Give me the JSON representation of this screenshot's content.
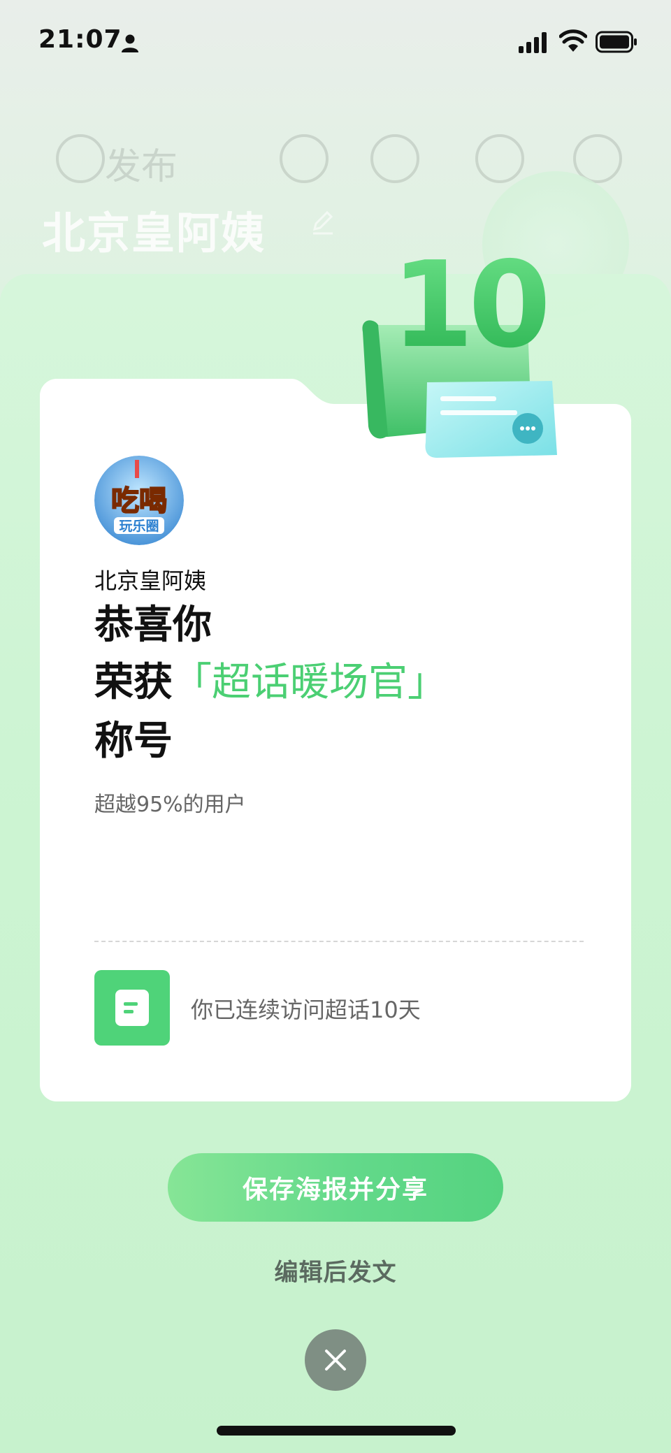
{
  "status_bar": {
    "time": "21:07"
  },
  "background": {
    "publish_label": "发布",
    "user_name": "北京皇阿姨"
  },
  "card": {
    "user_name": "北京皇阿姨",
    "congrats": "恭喜你",
    "award_prefix": "荣获",
    "award_name": "「超话暖场官」",
    "award_suffix": "称号",
    "rank_text": "超越95%的用户",
    "stat_text": "你已连续访问超话10天",
    "avatar_logo_text": "吃喝",
    "avatar_sub_text": "玩乐圈"
  },
  "illustration": {
    "number": "10"
  },
  "actions": {
    "share_label": "保存海报并分享",
    "edit_label": "编辑后发文"
  },
  "colors": {
    "accent": "#4bcf73",
    "button": "#63d98a",
    "close": "#7f8f84"
  }
}
